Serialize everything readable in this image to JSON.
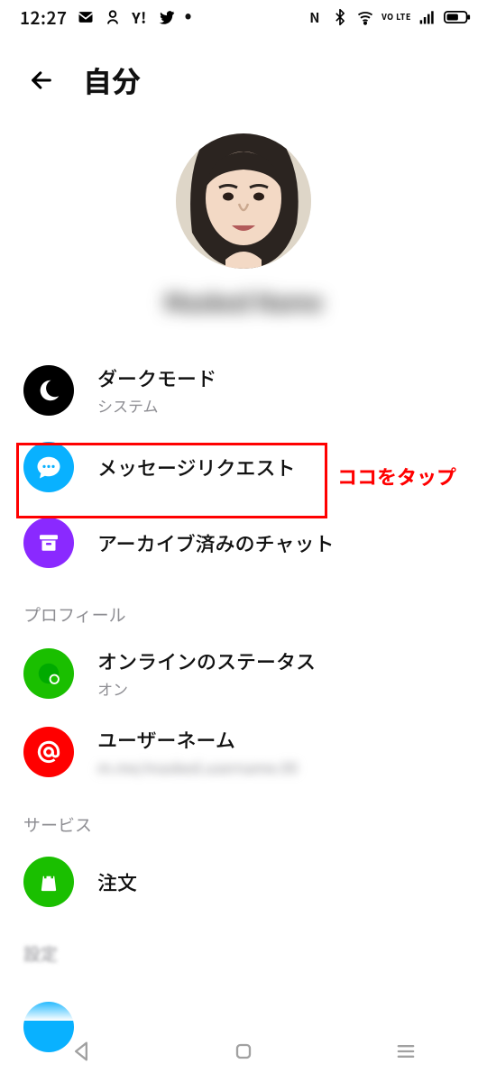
{
  "status": {
    "time": "12:27",
    "volte": "VO LTE"
  },
  "header": {
    "title": "自分"
  },
  "profile": {
    "name_masked": "Masked Name"
  },
  "items": {
    "dark": {
      "title": "ダークモード",
      "sub": "システム"
    },
    "msgreq": {
      "title": "メッセージリクエスト"
    },
    "arch": {
      "title": "アーカイブ済みのチャット"
    },
    "status": {
      "title": "オンラインのステータス",
      "sub": "オン"
    },
    "user": {
      "title": "ユーザーネーム",
      "sub_masked": "m.me/masked.username.00"
    },
    "order": {
      "title": "注文"
    }
  },
  "sections": {
    "profile": "プロフィール",
    "service": "サービス",
    "settings": "設定"
  },
  "annotation": {
    "callout": "ココをタップ"
  }
}
